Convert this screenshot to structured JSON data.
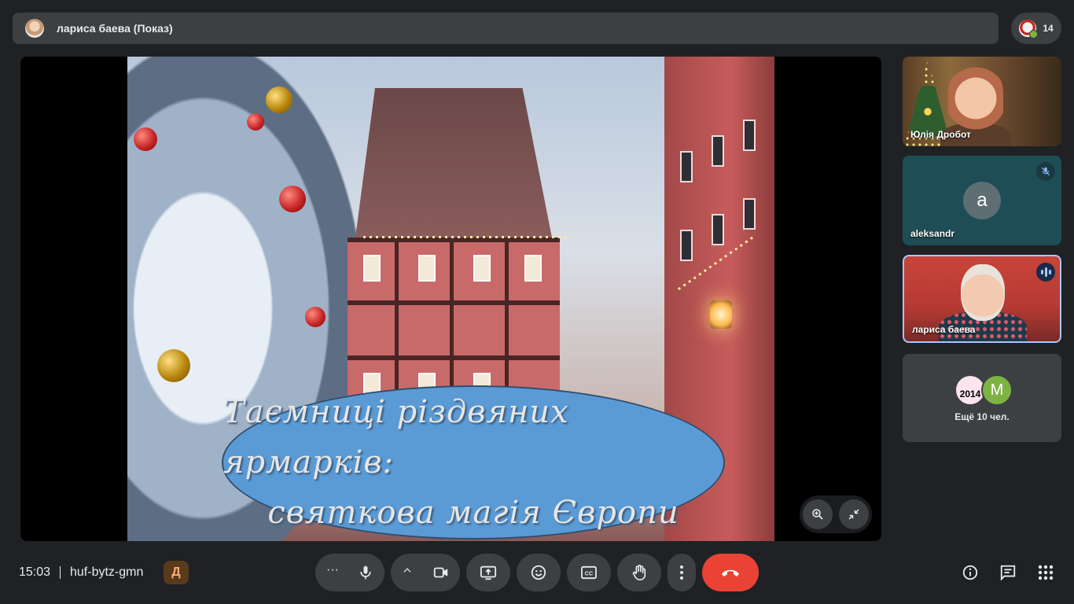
{
  "header": {
    "presenter_label": "лариса баева (Показ)",
    "participant_count": "14"
  },
  "presentation": {
    "title_line1": "Таємниці різдвяних ярмарків:",
    "title_line2": "святкова магія Європи"
  },
  "tiles": [
    {
      "name": "Юлія Дробот"
    },
    {
      "name": "aleksandr",
      "avatar_letter": "a",
      "muted": true
    },
    {
      "name": "лариса баева",
      "speaking": true
    },
    {
      "overflow_label": "Ещё 10 чел.",
      "avatar_text": "2014",
      "avatar_letter": "M"
    }
  ],
  "footer": {
    "time": "15:03",
    "meeting_code": "huf-bytz-gmn",
    "badge_glyph": "Д"
  },
  "icons": {
    "more": "more-horizontal-icon",
    "mic": "mic-icon",
    "camera": "camera-icon",
    "present": "present-screen-icon",
    "reactions": "emoji-icon",
    "captions": "captions-icon",
    "raise_hand": "hand-icon",
    "end_call": "end-call-icon"
  },
  "colors": {
    "background": "#202124",
    "control": "#3c4043",
    "end_call": "#ea4335",
    "speaking_outline": "#a8c7fa",
    "slide_banner": "#5b9bd5"
  }
}
